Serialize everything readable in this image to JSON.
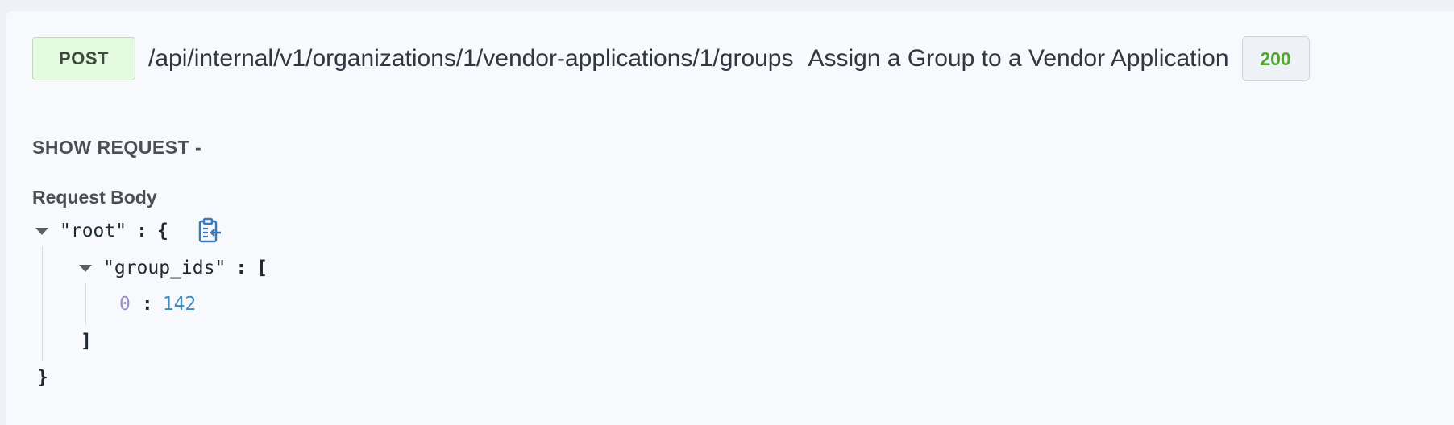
{
  "endpoint": {
    "method": "POST",
    "path": "/api/internal/v1/organizations/1/vendor-applications/1/groups",
    "summary": "Assign a Group to a Vendor Application",
    "status": "200"
  },
  "request": {
    "toggle_label": "SHOW REQUEST -",
    "body_label": "Request Body"
  },
  "json_tree": {
    "root_key": "\"root\"",
    "root_open": "{",
    "root_close": "}",
    "array_key": "\"group_ids\"",
    "array_open": "[",
    "array_close": "]",
    "separator": ":",
    "items": [
      {
        "index": "0",
        "value": "142"
      }
    ]
  },
  "colors": {
    "method_badge_bg": "#e4fbe0",
    "status_text": "#55a630",
    "number_value": "#3d8bbf",
    "array_index": "#9a8fc8",
    "copy_icon": "#3a7ab8"
  },
  "icons": {
    "copy": "clipboard-copy-icon",
    "expand": "caret-down-icon"
  }
}
